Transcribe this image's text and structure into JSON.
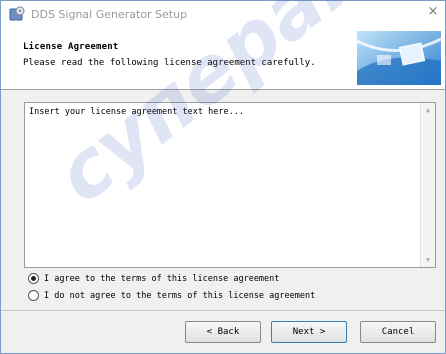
{
  "window": {
    "title": "DDS Signal Generator Setup",
    "close_symbol": "×"
  },
  "header": {
    "title": "License Agreement",
    "subtitle": "Please read the following license agreement carefully."
  },
  "license": {
    "text": "Insert your license agreement text here..."
  },
  "options": {
    "agree_label": "I agree to the terms of this license agreement",
    "disagree_label": "I do not agree to the terms of this license agreement",
    "selected": "agree"
  },
  "buttons": {
    "back_label": "< Back",
    "next_label": "Next >",
    "cancel_label": "Cancel"
  },
  "watermark": {
    "text": "суперайс"
  },
  "icons": {
    "app": "setup-disk-icon",
    "close": "close-icon",
    "banner": "installer-banner-icon",
    "scroll_up": "scroll-up-arrow-icon",
    "scroll_down": "scroll-down-arrow-icon"
  },
  "colors": {
    "window_border": "#7a9cc7",
    "banner_blue": "#2f7fd0",
    "watermark": "#3c5fbe"
  }
}
